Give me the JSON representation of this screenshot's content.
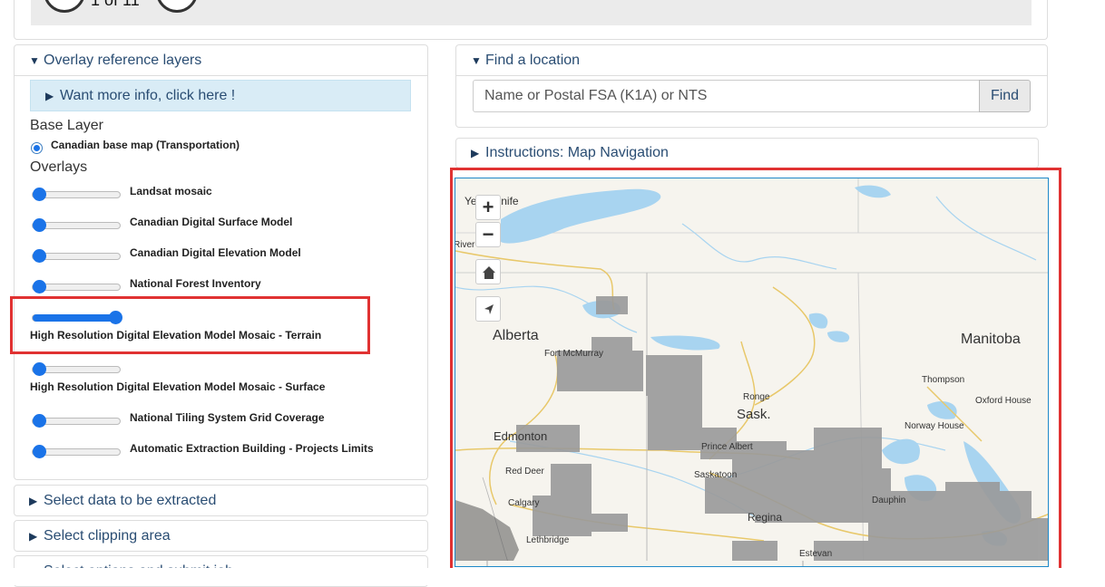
{
  "pager": {
    "text": "1 of 11"
  },
  "overlay_panel": {
    "title": "Overlay reference layers",
    "info_link": "Want more info, click here !",
    "base_layer_label": "Base Layer",
    "base_map_option": "Canadian base map (Transportation)",
    "overlays_label": "Overlays",
    "overlays": [
      {
        "label": "Landsat mosaic",
        "opacity": 0
      },
      {
        "label": "Canadian Digital Surface Model",
        "opacity": 0
      },
      {
        "label": "Canadian Digital Elevation Model",
        "opacity": 0
      },
      {
        "label": "National Forest Inventory",
        "opacity": 0
      },
      {
        "label": "High Resolution Digital Elevation Model Mosaic - Terrain",
        "opacity": 1
      },
      {
        "label": "High Resolution Digital Elevation Model Mosaic - Surface",
        "opacity": 0
      },
      {
        "label": "National Tiling System Grid Coverage",
        "opacity": 0
      },
      {
        "label": "Automatic Extraction Building - Projects Limits",
        "opacity": 0
      }
    ]
  },
  "sections": {
    "select_data": "Select data to be extracted",
    "select_clipping": "Select clipping area",
    "select_options": "Select options and submit job"
  },
  "find_location": {
    "title": "Find a location",
    "placeholder": "Name or Postal FSA (K1A) or NTS",
    "button": "Find"
  },
  "instructions": {
    "title": "Instructions: Map Navigation"
  },
  "map": {
    "controls": {
      "zoom_in": "+",
      "zoom_out": "−"
    },
    "labels": {
      "yellowknife": "Yellowknife",
      "river": "River",
      "alberta": "Alberta",
      "fort_mcmurray": "Fort McMurray",
      "manitoba": "Manitoba",
      "thompson": "Thompson",
      "oxford_house": "Oxford House",
      "norway_house": "Norway House",
      "ronge": "Ronge",
      "sask": "Sask.",
      "prince_albert": "Prince Albert",
      "edmonton": "Edmonton",
      "red_deer": "Red Deer",
      "saskatoon": "Saskatoon",
      "calgary": "Calgary",
      "regina": "Regina",
      "dauphin": "Dauphin",
      "lethbridge": "Lethbridge",
      "estevan": "Estevan"
    }
  },
  "colors": {
    "link": "#2a4d73",
    "accent": "#1a73e8",
    "highlight": "#e03232",
    "info_bg": "#d9ecf6",
    "map_water": "#a8d4f0",
    "map_roads": "#e8c86a",
    "dem_gray": "#9a9a9a"
  }
}
